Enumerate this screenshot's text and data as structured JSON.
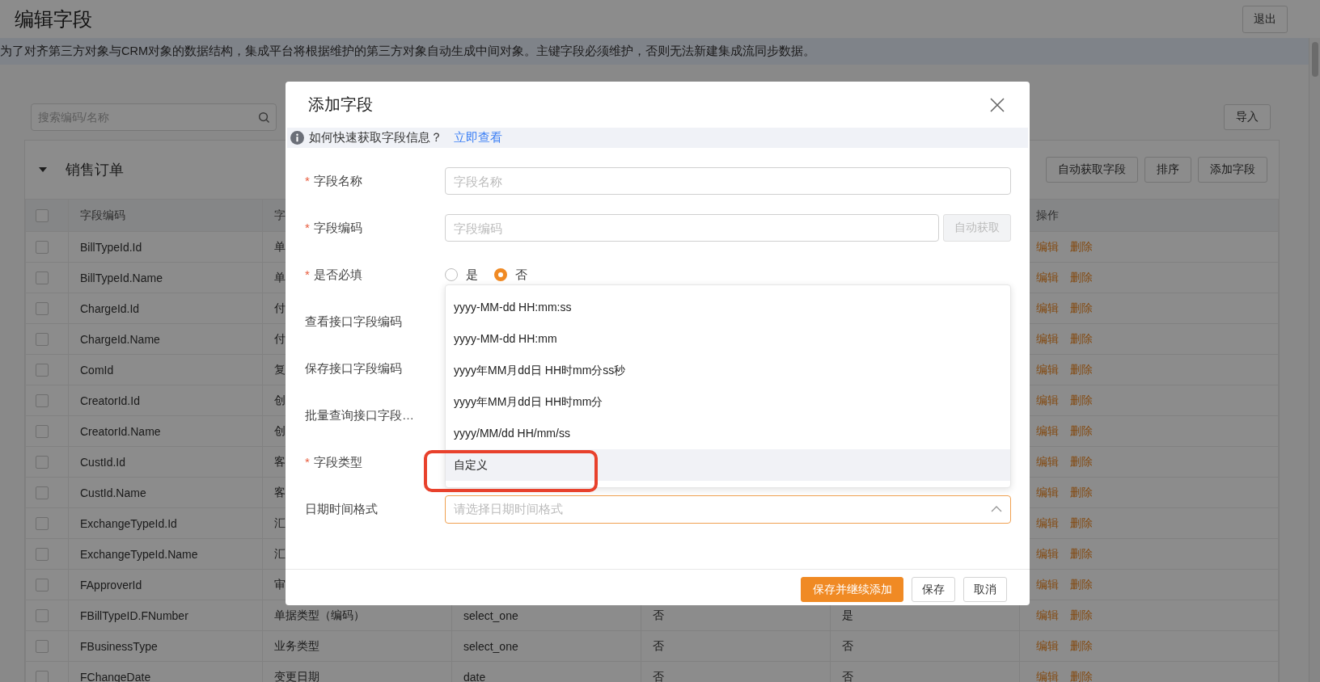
{
  "page": {
    "title": "编辑字段",
    "exit_button": "退出",
    "notice": "为了对齐第三方对象与CRM对象的数据结构，集成平台将根据维护的第三方对象自动生成中间对象。主键字段必须维护，否则无法新建集成流同步数据。",
    "search": {
      "placeholder": "搜索编码/名称"
    },
    "import_button": "导入"
  },
  "section": {
    "title": "销售订单",
    "expanded": true,
    "buttons": [
      "自动获取字段",
      "排序",
      "添加字段"
    ]
  },
  "table": {
    "select_all": {
      "checked": false
    },
    "columns": [
      {
        "label": "字段编码"
      },
      {
        "label": "字"
      },
      null,
      null,
      null,
      {
        "label": "操作"
      }
    ],
    "rows": [
      {
        "checked": false,
        "cells": [
          "BillTypeId.Id",
          "单"
        ],
        "actions": [
          "编辑",
          "删除"
        ]
      },
      {
        "checked": false,
        "cells": [
          "BillTypeId.Name",
          "单"
        ],
        "actions": [
          "编辑",
          "删除"
        ]
      },
      {
        "checked": false,
        "cells": [
          "ChargeId.Id",
          "付"
        ],
        "actions": [
          "编辑",
          "删除"
        ]
      },
      {
        "checked": false,
        "cells": [
          "ChargeId.Name",
          "付"
        ],
        "actions": [
          "编辑",
          "删除"
        ]
      },
      {
        "checked": false,
        "cells": [
          "ComId",
          "复"
        ],
        "actions": [
          "编辑",
          "删除"
        ]
      },
      {
        "checked": false,
        "cells": [
          "CreatorId.Id",
          "创"
        ],
        "actions": [
          "编辑",
          "删除"
        ]
      },
      {
        "checked": false,
        "cells": [
          "CreatorId.Name",
          "创"
        ],
        "actions": [
          "编辑",
          "删除"
        ]
      },
      {
        "checked": false,
        "cells": [
          "CustId.Id",
          "客"
        ],
        "actions": [
          "编辑",
          "删除"
        ]
      },
      {
        "checked": false,
        "cells": [
          "CustId.Name",
          "客"
        ],
        "actions": [
          "编辑",
          "删除"
        ]
      },
      {
        "checked": false,
        "cells": [
          "ExchangeTypeId.Id",
          "汇"
        ],
        "actions": [
          "编辑",
          "删除"
        ]
      },
      {
        "checked": false,
        "cells": [
          "ExchangeTypeId.Name",
          "汇"
        ],
        "actions": [
          "编辑",
          "删除"
        ]
      },
      {
        "checked": false,
        "cells": [
          "FApproverId",
          "审"
        ],
        "actions": [
          "编辑",
          "删除"
        ]
      },
      {
        "checked": false,
        "cells": [
          "FBillTypeID.FNumber",
          "单据类型（编码）",
          "select_one",
          "否",
          "是"
        ],
        "actions": [
          "编辑",
          "删除"
        ]
      },
      {
        "checked": false,
        "cells": [
          "FBusinessType",
          "业务类型",
          "select_one",
          "否",
          "否"
        ],
        "actions": [
          "编辑",
          "删除"
        ]
      },
      {
        "checked": false,
        "cells": [
          "FChangeDate",
          "变更日期",
          "date",
          "否",
          "否"
        ],
        "actions": [
          "编辑",
          "删除"
        ]
      }
    ]
  },
  "dialog": {
    "title": "添加字段",
    "info": {
      "text": "如何快速获取字段信息？",
      "link": "立即查看"
    },
    "fields": [
      {
        "kind": "input",
        "required_mark": "*",
        "label": "字段名称",
        "placeholder": "字段名称"
      },
      {
        "kind": "inputbutton",
        "required_mark": "*",
        "label": "字段编码",
        "placeholder": "字段编码",
        "button": "自动获取",
        "button_disabled": true
      },
      {
        "kind": "radio",
        "required_mark": "*",
        "label": "是否必填",
        "options": [
          {
            "label": "是",
            "selected": false
          },
          {
            "label": "否",
            "selected": true
          }
        ]
      },
      {
        "kind": "covered",
        "label": "查看接口字段编码"
      },
      {
        "kind": "covered",
        "label": "保存接口字段编码"
      },
      {
        "kind": "covered",
        "label": "批量查询接口字段…"
      },
      {
        "kind": "covered",
        "required_mark": "*",
        "label": "字段类型"
      },
      {
        "kind": "select",
        "label": "日期时间格式",
        "placeholder": "请选择日期时间格式",
        "open": true
      }
    ],
    "dropdown": [
      {
        "label": "yyyy-MM-dd HH:mm:ss",
        "highlighted": false
      },
      {
        "label": "yyyy-MM-dd HH:mm",
        "highlighted": false
      },
      {
        "label": "yyyy年MM月dd日 HH时mm分ss秒",
        "highlighted": false
      },
      {
        "label": "yyyy年MM月dd日 HH时mm分",
        "highlighted": false
      },
      {
        "label": "yyyy/MM/dd HH/mm/ss",
        "highlighted": false
      },
      {
        "label": "自定义",
        "highlighted": true
      }
    ],
    "buttons": [
      {
        "label": "保存并继续添加",
        "primary": true
      },
      {
        "label": "保存",
        "primary": false
      },
      {
        "label": "取消",
        "primary": false
      }
    ]
  },
  "annotations": [
    {
      "kind": "rectangle"
    }
  ]
}
